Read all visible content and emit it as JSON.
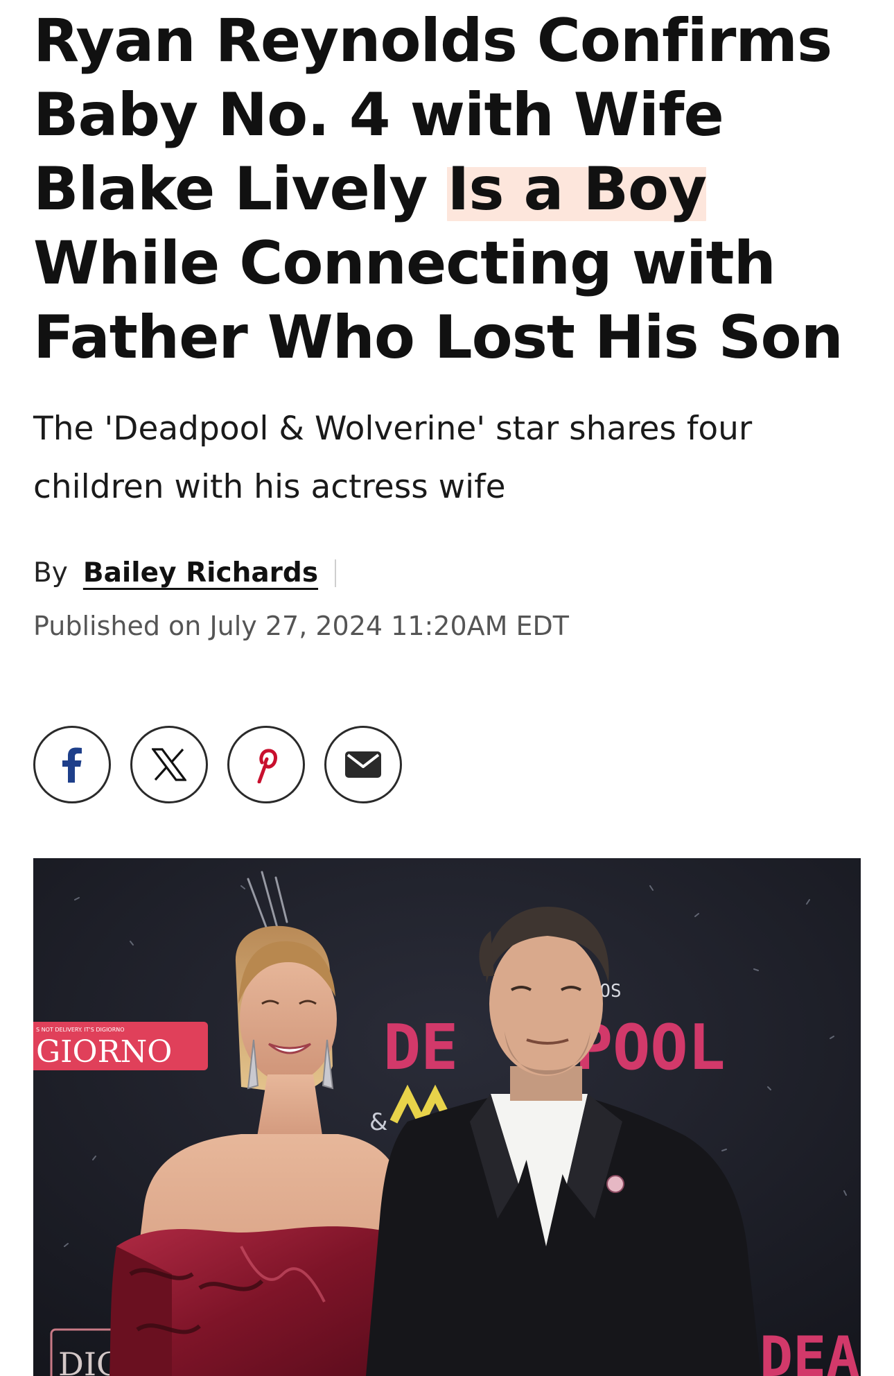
{
  "article": {
    "headline_part1": "Ryan Reynolds Confirms Baby No. 4 with Wife Blake Lively ",
    "headline_highlight": "Is a Boy",
    "headline_part2": " While Connecting with Father Who Lost His Son",
    "dek": "The 'Deadpool & Wolverine' star shares four children with his actress wife",
    "byline_prefix": "By",
    "author": "Bailey Richards",
    "published": "Published on July 27, 2024 11:20AM EDT"
  },
  "share": {
    "buttons": [
      {
        "icon": "facebook-icon",
        "color": "#1e3f8a"
      },
      {
        "icon": "x-icon",
        "color": "#111111"
      },
      {
        "icon": "pinterest-icon",
        "color": "#c8102e"
      },
      {
        "icon": "email-icon",
        "color": "#2a2a2a"
      }
    ]
  },
  "hero_image": {
    "backdrop_texts": {
      "giorno_tagline": "S NOT DELIVERY. IT'S DIGIORNO",
      "giorno_logo": "GIORNO",
      "studios": "DIOS",
      "title_left": "DE",
      "title_right": "POOL",
      "ampersand": "&",
      "bottom_left": "DIG",
      "bottom_right": "DEA"
    },
    "colors": {
      "backdrop": "#1b1c24",
      "logo_red": "#e0405a",
      "dress": "#8a1a2e",
      "suit": "#16161a",
      "shirt": "#f4f4f2"
    }
  }
}
